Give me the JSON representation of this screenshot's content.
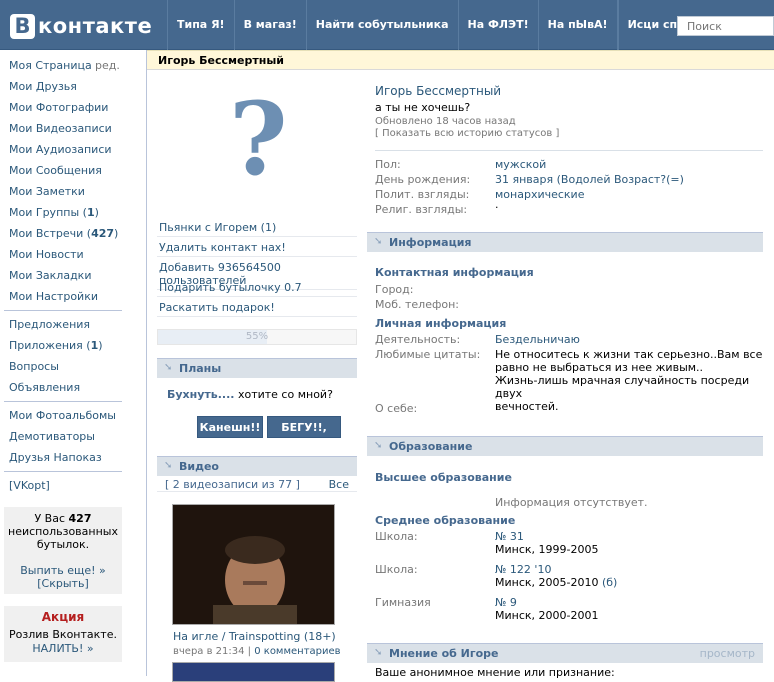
{
  "header": {
    "logo_letter": "В",
    "logo_text": "контакте",
    "nav": [
      "Типа Я!",
      "В магаз!",
      "Найти собутыльника",
      "На ФЛЭТ!",
      "На пЫвА!",
      "Исци спать!"
    ],
    "search_placeholder": "Поиск"
  },
  "sidebar": {
    "items": [
      {
        "label": "Моя Страница",
        "extra": "ред."
      },
      {
        "label": "Мои Друзья"
      },
      {
        "label": "Мои Фотографии"
      },
      {
        "label": "Мои Видеозаписи"
      },
      {
        "label": "Мои Аудиозаписи"
      },
      {
        "label": "Мои Сообщения"
      },
      {
        "label": "Мои Заметки"
      },
      {
        "label": "Мои Группы (",
        "count": "1",
        "tail": ")"
      },
      {
        "label": "Мои Встречи (",
        "count": "427",
        "tail": ")"
      },
      {
        "label": "Мои Новости"
      },
      {
        "label": "Мои Закладки"
      },
      {
        "label": "Мои Настройки"
      }
    ],
    "items2": [
      {
        "label": "Предложения"
      },
      {
        "label": "Приложения (",
        "count": "1",
        "tail": ")"
      },
      {
        "label": "Вопросы"
      },
      {
        "label": "Объявления"
      }
    ],
    "items3": [
      "Мои Фотоальбомы",
      "Демотиваторы",
      "Друзья Напоказ"
    ],
    "vkopt": "[VKopt]",
    "bottles": {
      "line1": "У Вас",
      "count": "427",
      "line2": "неиспользованных",
      "line3": "бутылок.",
      "link1": "Выпить еще! »",
      "link2": "[Скрыть]"
    },
    "promo": {
      "title": "Акция",
      "line1": "Розлив Вконтакте.",
      "link": "НАЛИТЬ! »"
    }
  },
  "profile": {
    "name": "Игорь Бессмертный",
    "photo_glyph": "?",
    "actions": [
      "Пьянки с Игорем (1)",
      "Удалить контакт нах!",
      "Добавить 936564500 пользователей",
      "Подарить бутылочку 0.7",
      "Раскатить подарок!"
    ],
    "progress": {
      "value": 0.55,
      "label": "55%"
    },
    "plans": {
      "title": "Планы",
      "text_bold": "Бухнуть....",
      "text_rest": " хотите со мной?",
      "btn1": "Канешн!!",
      "btn2": "БЕГУ!!, уже"
    },
    "video": {
      "title": "Видео",
      "count_text": "[ 2 видеозаписи из 77 ]",
      "all": "Все",
      "caption": "На игле / Trainspotting (18+)",
      "meta": "вчера в 21:34",
      "comments": "0 комментариев"
    },
    "status": "а ты не хочешь?",
    "updated": "Обновлено 18 часов назад",
    "history": "[ Показать всю историю статусов ]",
    "info_rows": [
      {
        "label": "Пол:",
        "value": "мужской"
      },
      {
        "label": "День рождения:",
        "value": "31 января (Водолей Возраст?(=)"
      },
      {
        "label": "Полит. взгляды:",
        "value": "монархические"
      },
      {
        "label": "Религ. взгляды:",
        "value": "."
      }
    ],
    "info": {
      "title": "Информация",
      "contact_title": "Контактная информация",
      "city_label": "Город:",
      "phone_label": "Моб. телефон:",
      "personal_title": "Личная информация",
      "activity_label": "Деятельность:",
      "activity_value": "Бездельничаю",
      "quotes_label": "Любимые цитаты:",
      "quotes_lines": [
        "Не относитесь к жизни так серьезно..Вам все",
        "равно не выбраться из нее живым..",
        "Жизнь-лишь мрачная случайность посреди двух",
        "вечностей."
      ],
      "about_label": "О себе:",
      "about_value": "."
    },
    "education": {
      "title": "Образование",
      "higher_title": "Высшее образование",
      "no_info": "Информация отсутствует.",
      "secondary_title": "Среднее образование",
      "schools": [
        {
          "label": "Школа:",
          "name": "№ 31",
          "detail": "Минск, 1999-2005",
          "extra": ""
        },
        {
          "label": "Школа:",
          "name": "№ 122 '10",
          "detail": "Минск, 2005-2010 ",
          "extra": "(б)"
        },
        {
          "label": "Гимназия",
          "name": "№ 9",
          "detail": "Минск, 2000-2001",
          "extra": ""
        }
      ]
    },
    "opinion": {
      "title": "Мнение об Игоре",
      "view": "просмотр",
      "text": "Ваше анонимное мнение или признание:"
    }
  }
}
